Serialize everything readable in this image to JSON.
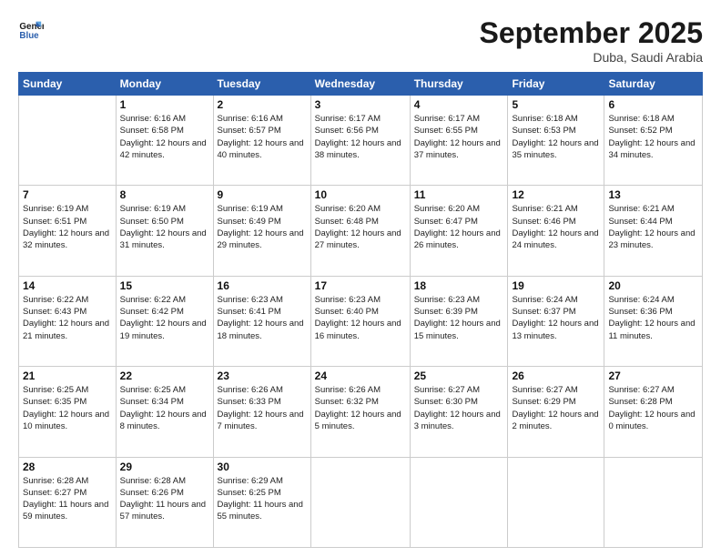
{
  "header": {
    "logo_general": "General",
    "logo_blue": "Blue",
    "month_title": "September 2025",
    "subtitle": "Duba, Saudi Arabia"
  },
  "days_of_week": [
    "Sunday",
    "Monday",
    "Tuesday",
    "Wednesday",
    "Thursday",
    "Friday",
    "Saturday"
  ],
  "weeks": [
    [
      {
        "day": "",
        "sunrise": "",
        "sunset": "",
        "daylight": ""
      },
      {
        "day": "1",
        "sunrise": "Sunrise: 6:16 AM",
        "sunset": "Sunset: 6:58 PM",
        "daylight": "Daylight: 12 hours and 42 minutes."
      },
      {
        "day": "2",
        "sunrise": "Sunrise: 6:16 AM",
        "sunset": "Sunset: 6:57 PM",
        "daylight": "Daylight: 12 hours and 40 minutes."
      },
      {
        "day": "3",
        "sunrise": "Sunrise: 6:17 AM",
        "sunset": "Sunset: 6:56 PM",
        "daylight": "Daylight: 12 hours and 38 minutes."
      },
      {
        "day": "4",
        "sunrise": "Sunrise: 6:17 AM",
        "sunset": "Sunset: 6:55 PM",
        "daylight": "Daylight: 12 hours and 37 minutes."
      },
      {
        "day": "5",
        "sunrise": "Sunrise: 6:18 AM",
        "sunset": "Sunset: 6:53 PM",
        "daylight": "Daylight: 12 hours and 35 minutes."
      },
      {
        "day": "6",
        "sunrise": "Sunrise: 6:18 AM",
        "sunset": "Sunset: 6:52 PM",
        "daylight": "Daylight: 12 hours and 34 minutes."
      }
    ],
    [
      {
        "day": "7",
        "sunrise": "Sunrise: 6:19 AM",
        "sunset": "Sunset: 6:51 PM",
        "daylight": "Daylight: 12 hours and 32 minutes."
      },
      {
        "day": "8",
        "sunrise": "Sunrise: 6:19 AM",
        "sunset": "Sunset: 6:50 PM",
        "daylight": "Daylight: 12 hours and 31 minutes."
      },
      {
        "day": "9",
        "sunrise": "Sunrise: 6:19 AM",
        "sunset": "Sunset: 6:49 PM",
        "daylight": "Daylight: 12 hours and 29 minutes."
      },
      {
        "day": "10",
        "sunrise": "Sunrise: 6:20 AM",
        "sunset": "Sunset: 6:48 PM",
        "daylight": "Daylight: 12 hours and 27 minutes."
      },
      {
        "day": "11",
        "sunrise": "Sunrise: 6:20 AM",
        "sunset": "Sunset: 6:47 PM",
        "daylight": "Daylight: 12 hours and 26 minutes."
      },
      {
        "day": "12",
        "sunrise": "Sunrise: 6:21 AM",
        "sunset": "Sunset: 6:46 PM",
        "daylight": "Daylight: 12 hours and 24 minutes."
      },
      {
        "day": "13",
        "sunrise": "Sunrise: 6:21 AM",
        "sunset": "Sunset: 6:44 PM",
        "daylight": "Daylight: 12 hours and 23 minutes."
      }
    ],
    [
      {
        "day": "14",
        "sunrise": "Sunrise: 6:22 AM",
        "sunset": "Sunset: 6:43 PM",
        "daylight": "Daylight: 12 hours and 21 minutes."
      },
      {
        "day": "15",
        "sunrise": "Sunrise: 6:22 AM",
        "sunset": "Sunset: 6:42 PM",
        "daylight": "Daylight: 12 hours and 19 minutes."
      },
      {
        "day": "16",
        "sunrise": "Sunrise: 6:23 AM",
        "sunset": "Sunset: 6:41 PM",
        "daylight": "Daylight: 12 hours and 18 minutes."
      },
      {
        "day": "17",
        "sunrise": "Sunrise: 6:23 AM",
        "sunset": "Sunset: 6:40 PM",
        "daylight": "Daylight: 12 hours and 16 minutes."
      },
      {
        "day": "18",
        "sunrise": "Sunrise: 6:23 AM",
        "sunset": "Sunset: 6:39 PM",
        "daylight": "Daylight: 12 hours and 15 minutes."
      },
      {
        "day": "19",
        "sunrise": "Sunrise: 6:24 AM",
        "sunset": "Sunset: 6:37 PM",
        "daylight": "Daylight: 12 hours and 13 minutes."
      },
      {
        "day": "20",
        "sunrise": "Sunrise: 6:24 AM",
        "sunset": "Sunset: 6:36 PM",
        "daylight": "Daylight: 12 hours and 11 minutes."
      }
    ],
    [
      {
        "day": "21",
        "sunrise": "Sunrise: 6:25 AM",
        "sunset": "Sunset: 6:35 PM",
        "daylight": "Daylight: 12 hours and 10 minutes."
      },
      {
        "day": "22",
        "sunrise": "Sunrise: 6:25 AM",
        "sunset": "Sunset: 6:34 PM",
        "daylight": "Daylight: 12 hours and 8 minutes."
      },
      {
        "day": "23",
        "sunrise": "Sunrise: 6:26 AM",
        "sunset": "Sunset: 6:33 PM",
        "daylight": "Daylight: 12 hours and 7 minutes."
      },
      {
        "day": "24",
        "sunrise": "Sunrise: 6:26 AM",
        "sunset": "Sunset: 6:32 PM",
        "daylight": "Daylight: 12 hours and 5 minutes."
      },
      {
        "day": "25",
        "sunrise": "Sunrise: 6:27 AM",
        "sunset": "Sunset: 6:30 PM",
        "daylight": "Daylight: 12 hours and 3 minutes."
      },
      {
        "day": "26",
        "sunrise": "Sunrise: 6:27 AM",
        "sunset": "Sunset: 6:29 PM",
        "daylight": "Daylight: 12 hours and 2 minutes."
      },
      {
        "day": "27",
        "sunrise": "Sunrise: 6:27 AM",
        "sunset": "Sunset: 6:28 PM",
        "daylight": "Daylight: 12 hours and 0 minutes."
      }
    ],
    [
      {
        "day": "28",
        "sunrise": "Sunrise: 6:28 AM",
        "sunset": "Sunset: 6:27 PM",
        "daylight": "Daylight: 11 hours and 59 minutes."
      },
      {
        "day": "29",
        "sunrise": "Sunrise: 6:28 AM",
        "sunset": "Sunset: 6:26 PM",
        "daylight": "Daylight: 11 hours and 57 minutes."
      },
      {
        "day": "30",
        "sunrise": "Sunrise: 6:29 AM",
        "sunset": "Sunset: 6:25 PM",
        "daylight": "Daylight: 11 hours and 55 minutes."
      },
      {
        "day": "",
        "sunrise": "",
        "sunset": "",
        "daylight": ""
      },
      {
        "day": "",
        "sunrise": "",
        "sunset": "",
        "daylight": ""
      },
      {
        "day": "",
        "sunrise": "",
        "sunset": "",
        "daylight": ""
      },
      {
        "day": "",
        "sunrise": "",
        "sunset": "",
        "daylight": ""
      }
    ]
  ]
}
